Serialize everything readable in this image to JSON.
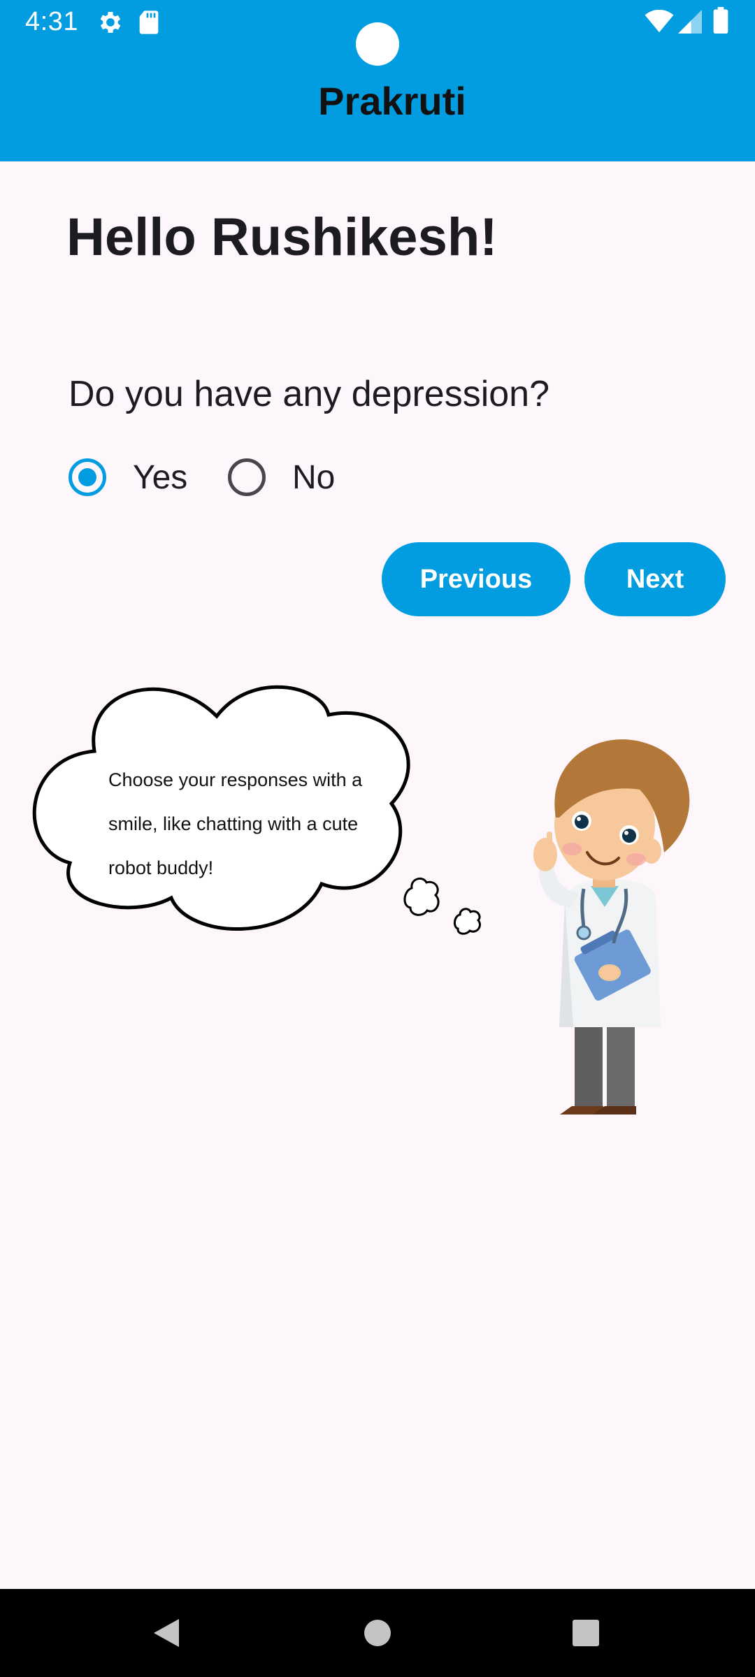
{
  "status_bar": {
    "time": "4:31",
    "icons": [
      "gear-icon",
      "sd-card-icon",
      "wifi-icon",
      "signal-icon",
      "battery-icon"
    ]
  },
  "app": {
    "title": "Prakruti"
  },
  "greeting": "Hello Rushikesh!",
  "question": {
    "text": "Do you have any depression?",
    "options": [
      {
        "label": "Yes",
        "selected": true
      },
      {
        "label": "No",
        "selected": false
      }
    ]
  },
  "buttons": {
    "previous": "Previous",
    "next": "Next"
  },
  "thought_bubble": {
    "line1": "Choose your responses with a",
    "line2": "smile, like chatting with a cute",
    "line3": "robot buddy!"
  },
  "colors": {
    "accent": "#029de0",
    "background": "#fdf7fb"
  },
  "nav": [
    "back-icon",
    "home-icon",
    "recents-icon"
  ]
}
